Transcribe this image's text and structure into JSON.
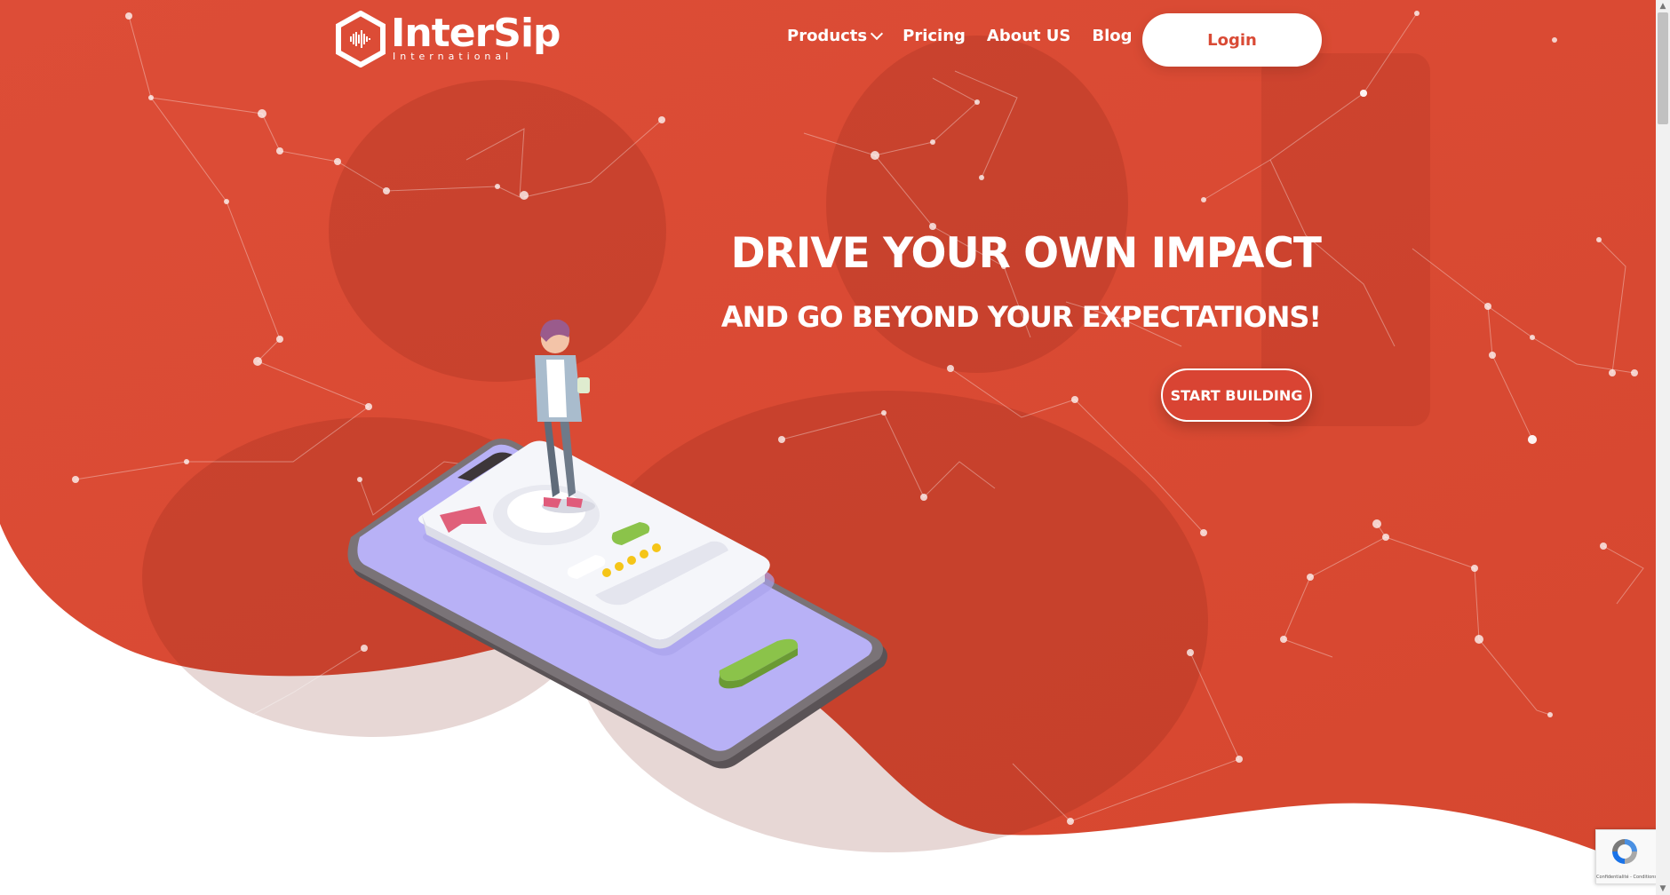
{
  "header": {
    "logo_text": "InterSip",
    "logo_sub": "International",
    "nav": [
      {
        "label": "Products"
      },
      {
        "label": "Pricing"
      },
      {
        "label": "About US"
      },
      {
        "label": "Blog"
      }
    ],
    "login_label": "Login"
  },
  "hero": {
    "headline": "DRIVE YOUR OWN IMPACT",
    "subline": "AND GO BEYOND YOUR EXPECTATIONS!",
    "cta_label": "START BUILDING"
  },
  "recaptcha": {
    "footer_text": "Confidentialité - Conditions"
  },
  "colors": {
    "hero": "#d94a35",
    "accent_green": "#8bc34a",
    "phone_screen": "#b6b0f5"
  }
}
